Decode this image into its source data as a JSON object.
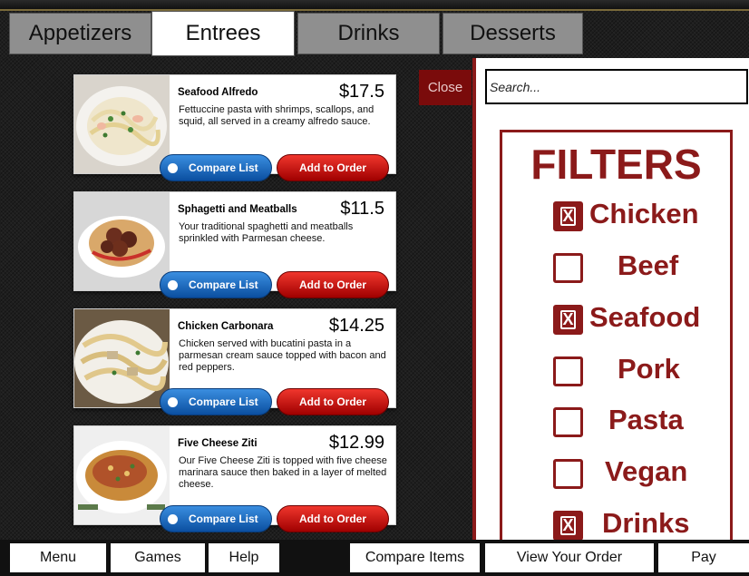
{
  "tabs": [
    {
      "label": "Appetizers",
      "active": false
    },
    {
      "label": "Entrees",
      "active": true
    },
    {
      "label": "Drinks",
      "active": false
    },
    {
      "label": "Desserts",
      "active": false
    }
  ],
  "menu": {
    "close_label": "Close",
    "compare_label": "Compare List",
    "add_label": "Add to Order",
    "items": [
      {
        "name": "Seafood Alfredo",
        "price": "$17.5",
        "description": "Fettuccine pasta with shrimps, scallops, and squid, all served in a creamy alfredo sauce."
      },
      {
        "name": "Sphagetti and Meatballs",
        "price": "$11.5",
        "description": "Your traditional spaghetti and meatballs sprinkled with Parmesan cheese."
      },
      {
        "name": "Chicken Carbonara",
        "price": "$14.25",
        "description": "Chicken served with bucatini pasta in a parmesan cream sauce topped with bacon and red peppers."
      },
      {
        "name": "Five Cheese Ziti",
        "price": "$12.99",
        "description": "Our Five Cheese Ziti is topped with five cheese marinara sauce then baked in a layer of melted cheese."
      }
    ]
  },
  "search": {
    "placeholder": "Search..."
  },
  "filters": {
    "title": "FILTERS",
    "items": [
      {
        "label": "Chicken",
        "checked": true
      },
      {
        "label": "Beef",
        "checked": false
      },
      {
        "label": "Seafood",
        "checked": true
      },
      {
        "label": "Pork",
        "checked": false
      },
      {
        "label": "Pasta",
        "checked": false
      },
      {
        "label": "Vegan",
        "checked": false
      },
      {
        "label": "Drinks",
        "checked": true
      }
    ]
  },
  "bottom_nav": {
    "menu": "Menu",
    "games": "Games",
    "help": "Help",
    "compare": "Compare Items",
    "order": "View Your Order",
    "pay": "Pay"
  },
  "colors": {
    "accent": "#8b1a1a",
    "compare_blue": "#0b4fa0",
    "add_red": "#c00000"
  },
  "icons": {
    "checkbox_checked": "x-checkbox-icon",
    "compare_radio": "radio-dot-icon"
  }
}
